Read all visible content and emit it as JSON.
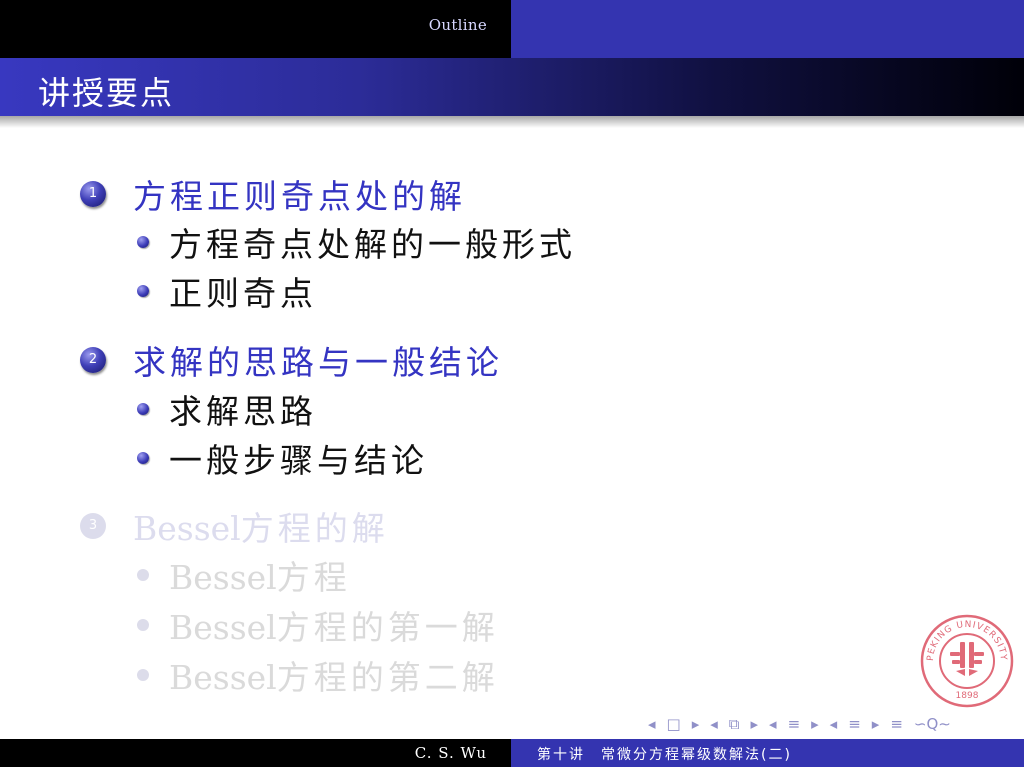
{
  "header": {
    "outline_label": "Outline"
  },
  "slide": {
    "title": "讲授要点"
  },
  "sections": [
    {
      "number": "1",
      "title": "方程正则奇点处的解",
      "items": [
        "方程奇点处解的一般形式",
        "正则奇点"
      ]
    },
    {
      "number": "2",
      "title": "求解的思路与一般结论",
      "items": [
        "求解思路",
        "一般步骤与结论"
      ]
    },
    {
      "number": "3",
      "title_latin": "Bessel",
      "title_cjk": "方程的解",
      "items": [
        {
          "latin": "Bessel",
          "cjk": "方程"
        },
        {
          "latin": "Bessel",
          "cjk": "方程的第一解"
        },
        {
          "latin": "Bessel",
          "cjk": "方程的第二解"
        }
      ]
    }
  ],
  "seal": {
    "text": "PEKING UNIVERSITY",
    "year": "1898",
    "color": "#e06a78"
  },
  "nav": {
    "prev_frame": "◂",
    "frame_icon": "□",
    "next_frame": "▸",
    "prev_subsection": "◂",
    "subsection_icon": "⧉",
    "next_subsection": "▸",
    "prev_section": "◂",
    "section_icon": "≡",
    "next_section": "▸",
    "prev_item": "◂",
    "item_icon": "≡",
    "next_item": "▸",
    "align": "≡",
    "search": "∽Q∼"
  },
  "footer": {
    "author": "C. S. Wu",
    "lecture": "第十讲　常微分方程幂级数解法(二)"
  },
  "colors": {
    "accent": "#3434b0",
    "bullet_text": "#3434c2",
    "faded": "#dcdcee"
  }
}
